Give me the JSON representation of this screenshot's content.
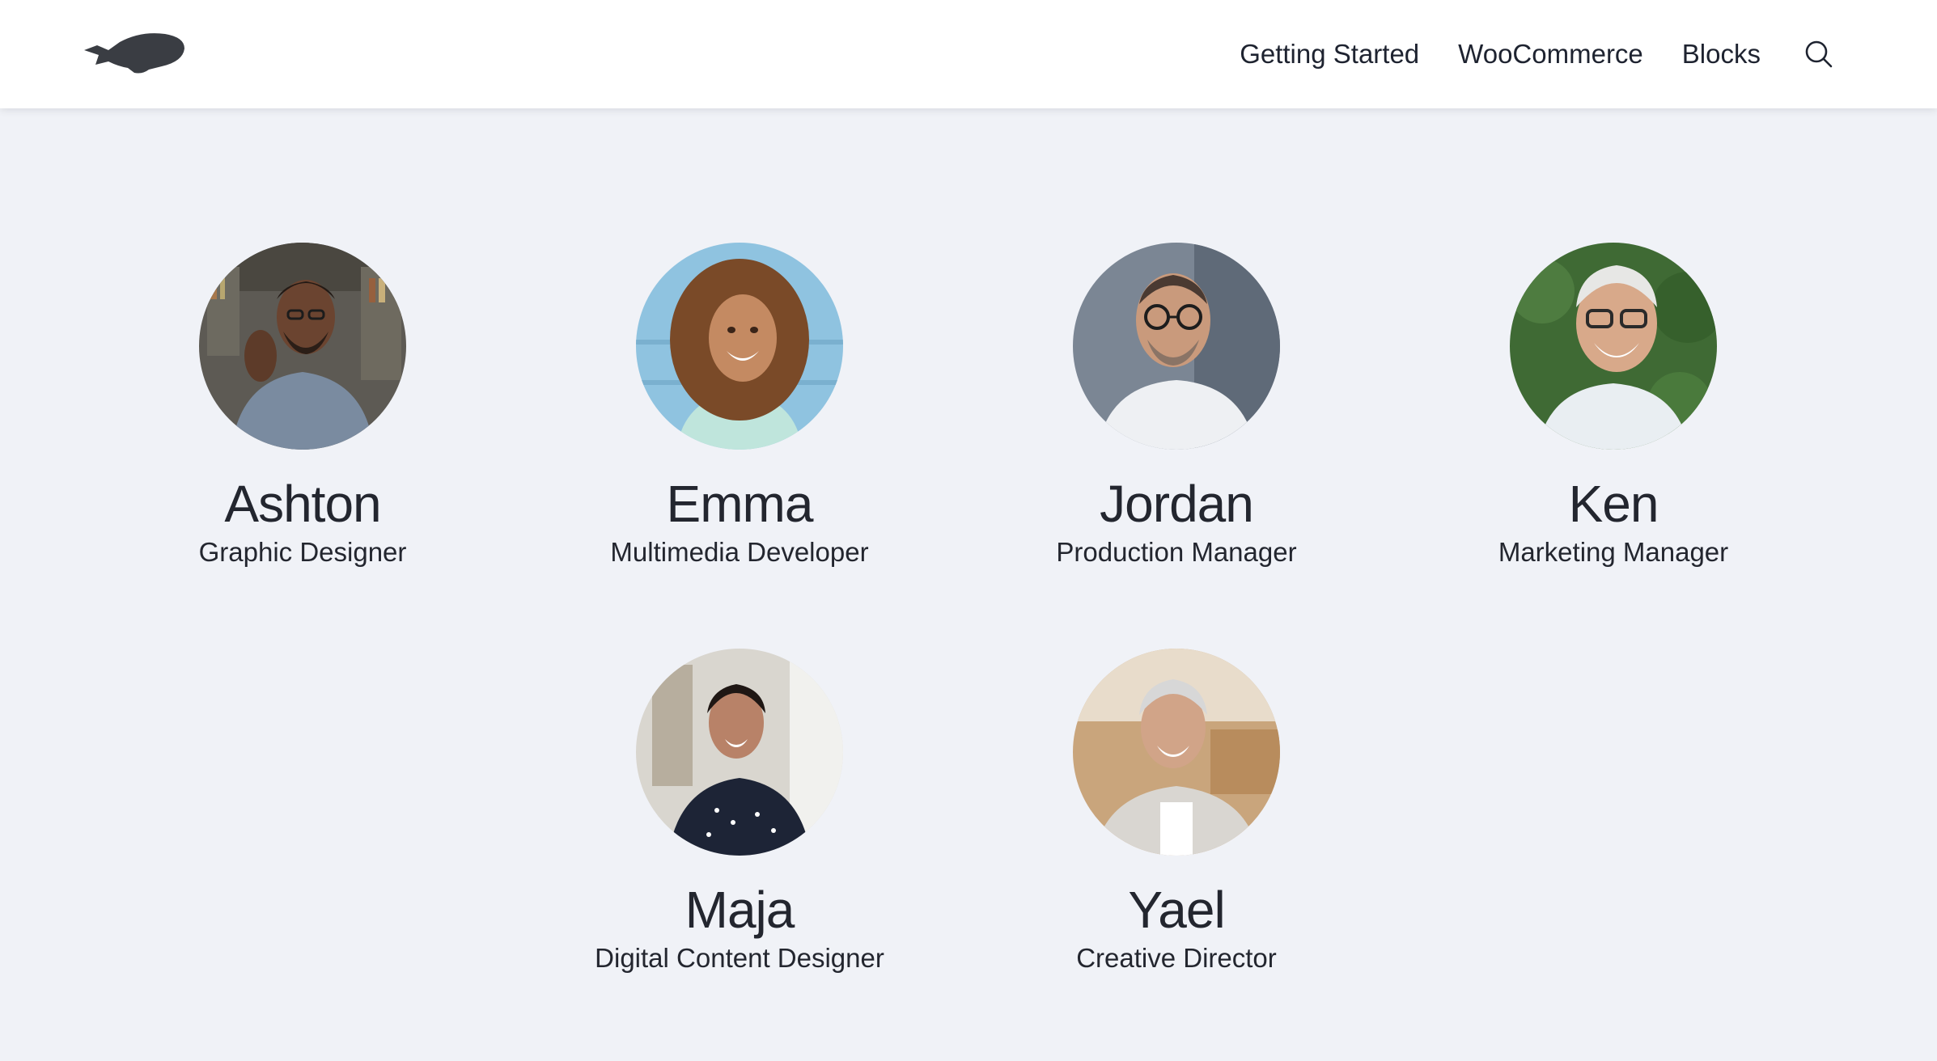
{
  "header": {
    "logo": "blimp-logo-icon",
    "nav": [
      {
        "label": "Getting Started"
      },
      {
        "label": "WooCommerce"
      },
      {
        "label": "Blocks"
      }
    ],
    "search_icon": "search-icon"
  },
  "team": [
    {
      "name": "Ashton",
      "role": "Graphic Designer"
    },
    {
      "name": "Emma",
      "role": "Multimedia Developer"
    },
    {
      "name": "Jordan",
      "role": "Production Manager"
    },
    {
      "name": "Ken",
      "role": "Marketing Manager"
    },
    {
      "name": "Maja",
      "role": "Digital Content Designer"
    },
    {
      "name": "Yael",
      "role": "Creative Director"
    }
  ]
}
